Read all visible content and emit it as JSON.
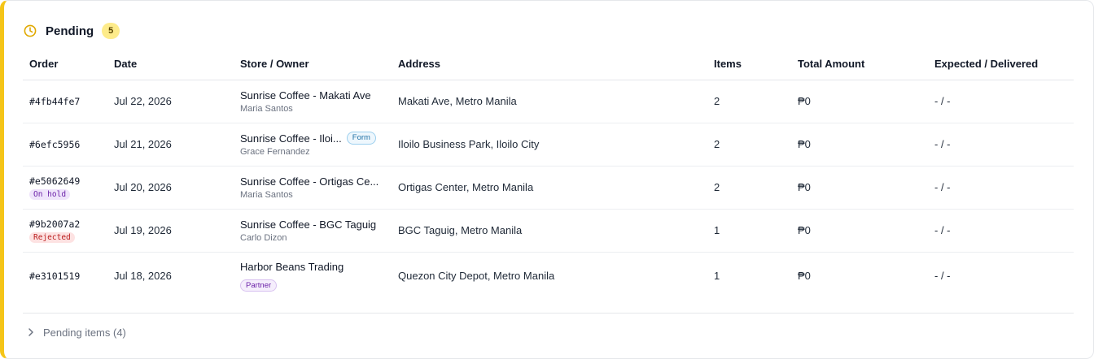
{
  "section": {
    "title": "Pending",
    "count": "5"
  },
  "columns": {
    "order": "Order",
    "date": "Date",
    "store": "Store / Owner",
    "address": "Address",
    "items": "Items",
    "total": "Total Amount",
    "expected": "Expected / Delivered"
  },
  "rows": [
    {
      "order_id": "#4fb44fe7",
      "status_tag": "",
      "date": "Jul 22, 2026",
      "store": "Sunrise Coffee - Makati Ave",
      "store_tag": "",
      "owner": "Maria Santos",
      "address": "Makati Ave, Metro Manila",
      "items": "2",
      "total": "₱0",
      "expected": "- / -"
    },
    {
      "order_id": "#6efc5956",
      "status_tag": "",
      "date": "Jul 21, 2026",
      "store": "Sunrise Coffee - Iloi...",
      "store_tag": "Form",
      "owner": "Grace Fernandez",
      "address": "Iloilo Business Park, Iloilo City",
      "items": "2",
      "total": "₱0",
      "expected": "- / -"
    },
    {
      "order_id": "#e5062649",
      "status_tag": "On hold",
      "date": "Jul 20, 2026",
      "store": "Sunrise Coffee - Ortigas Ce...",
      "store_tag": "",
      "owner": "Maria Santos",
      "address": "Ortigas Center, Metro Manila",
      "items": "2",
      "total": "₱0",
      "expected": "- / -"
    },
    {
      "order_id": "#9b2007a2",
      "status_tag": "Rejected",
      "date": "Jul 19, 2026",
      "store": "Sunrise Coffee - BGC Taguig",
      "store_tag": "",
      "owner": "Carlo Dizon",
      "address": "BGC Taguig, Metro Manila",
      "items": "1",
      "total": "₱0",
      "expected": "- / -"
    },
    {
      "order_id": "#e3101519",
      "status_tag": "",
      "date": "Jul 18, 2026",
      "store": "Harbor Beans Trading",
      "store_tag": "",
      "owner": "",
      "partner_tag": "Partner",
      "address": "Quezon City Depot, Metro Manila",
      "items": "1",
      "total": "₱0",
      "expected": "- / -"
    }
  ],
  "footer": {
    "label": "Pending items (4)"
  },
  "colors": {
    "accent": "#f5c518",
    "badge": "#fdeb8a",
    "on_hold": "#6b21a8",
    "rejected": "#b91c1c",
    "form_pill": "#1d6fa5"
  },
  "icons": {
    "header": "clock-icon",
    "footer": "chevron-right-icon"
  }
}
